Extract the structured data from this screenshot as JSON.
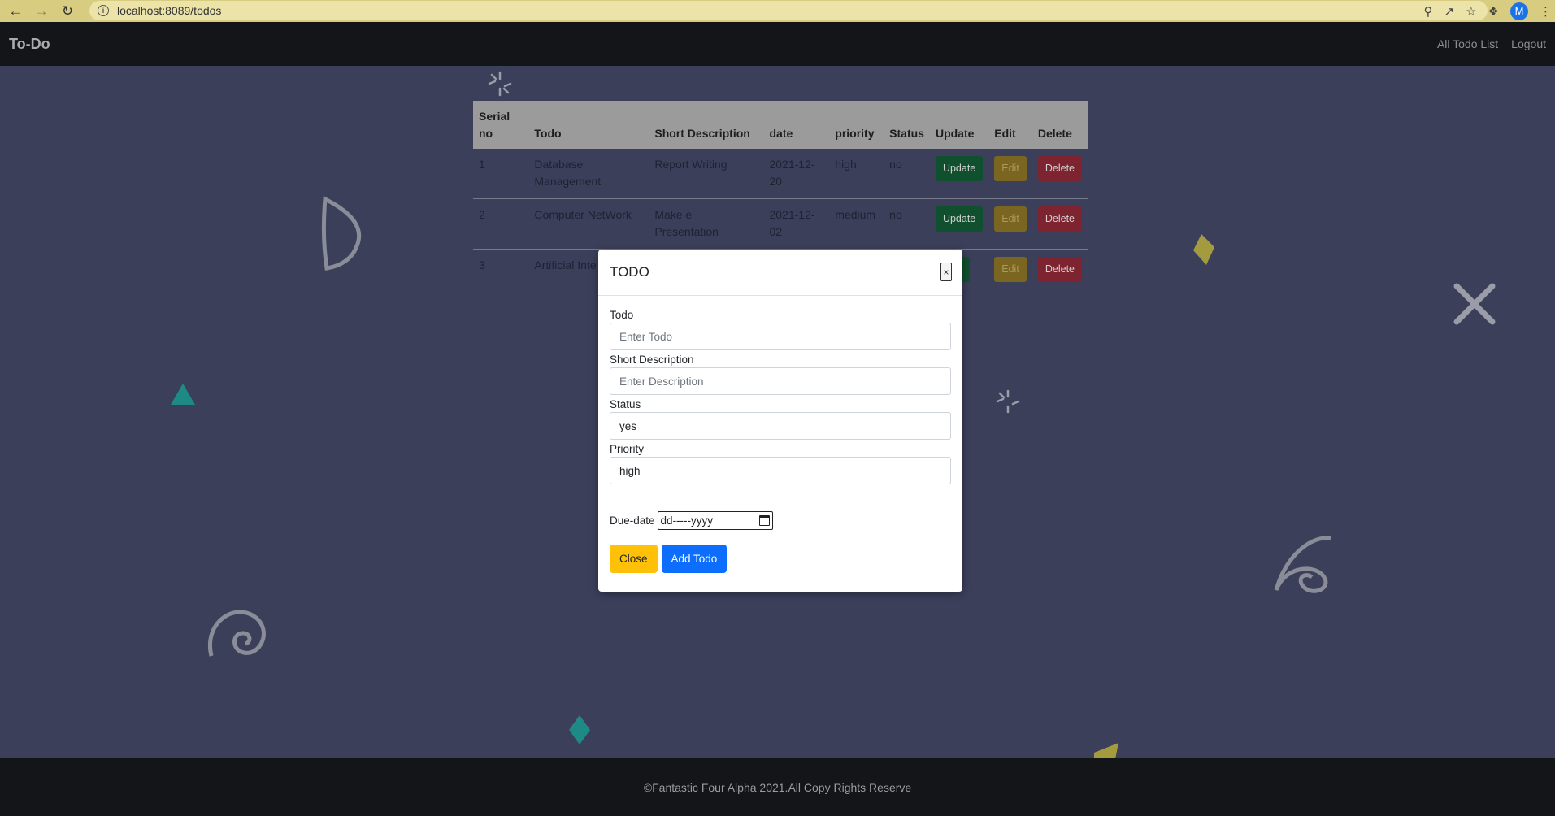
{
  "browser": {
    "url": "localhost:8089/todos",
    "avatar_letter": "M"
  },
  "navbar": {
    "brand": "To-Do",
    "links": [
      "All Todo List",
      "Logout"
    ]
  },
  "table": {
    "headers": [
      "Serial no",
      "Todo",
      "Short Description",
      "date",
      "priority",
      "Status",
      "Update",
      "Edit",
      "Delete"
    ],
    "rows": [
      {
        "serial": "1",
        "todo": "Database Management",
        "desc": "Report Writing",
        "date": "2021-12-20",
        "priority": "high",
        "status": "no"
      },
      {
        "serial": "2",
        "todo": "Computer NetWork",
        "desc": "Make e Presentation",
        "date": "2021-12-02",
        "priority": "medium",
        "status": "no"
      },
      {
        "serial": "3",
        "todo": "Artificial Inte",
        "desc": "",
        "date": "",
        "priority": "",
        "status": ""
      }
    ],
    "update_label": "Update",
    "edit_label": "Edit",
    "delete_label": "Delete",
    "update_partial_label": "date"
  },
  "modal": {
    "title": "TODO",
    "close_x": "×",
    "todo_label": "Todo",
    "todo_placeholder": "Enter Todo",
    "desc_label": "Short Description",
    "desc_placeholder": "Enter Description",
    "status_label": "Status",
    "status_value": "yes",
    "priority_label": "Priority",
    "priority_value": "high",
    "due_label": "Due-date",
    "due_placeholder": "dd-----yyyy",
    "close_button": "Close",
    "add_button": "Add Todo"
  },
  "footer": {
    "text": "©Fantastic Four Alpha 2021.All Copy Rights Reserve"
  },
  "colors": {
    "background": "#3b3f5a",
    "navbar": "#141519",
    "update": "#11502e",
    "edit": "#7a6620",
    "delete": "#7e2330",
    "primary": "#0d6efd",
    "warning": "#ffc107"
  }
}
